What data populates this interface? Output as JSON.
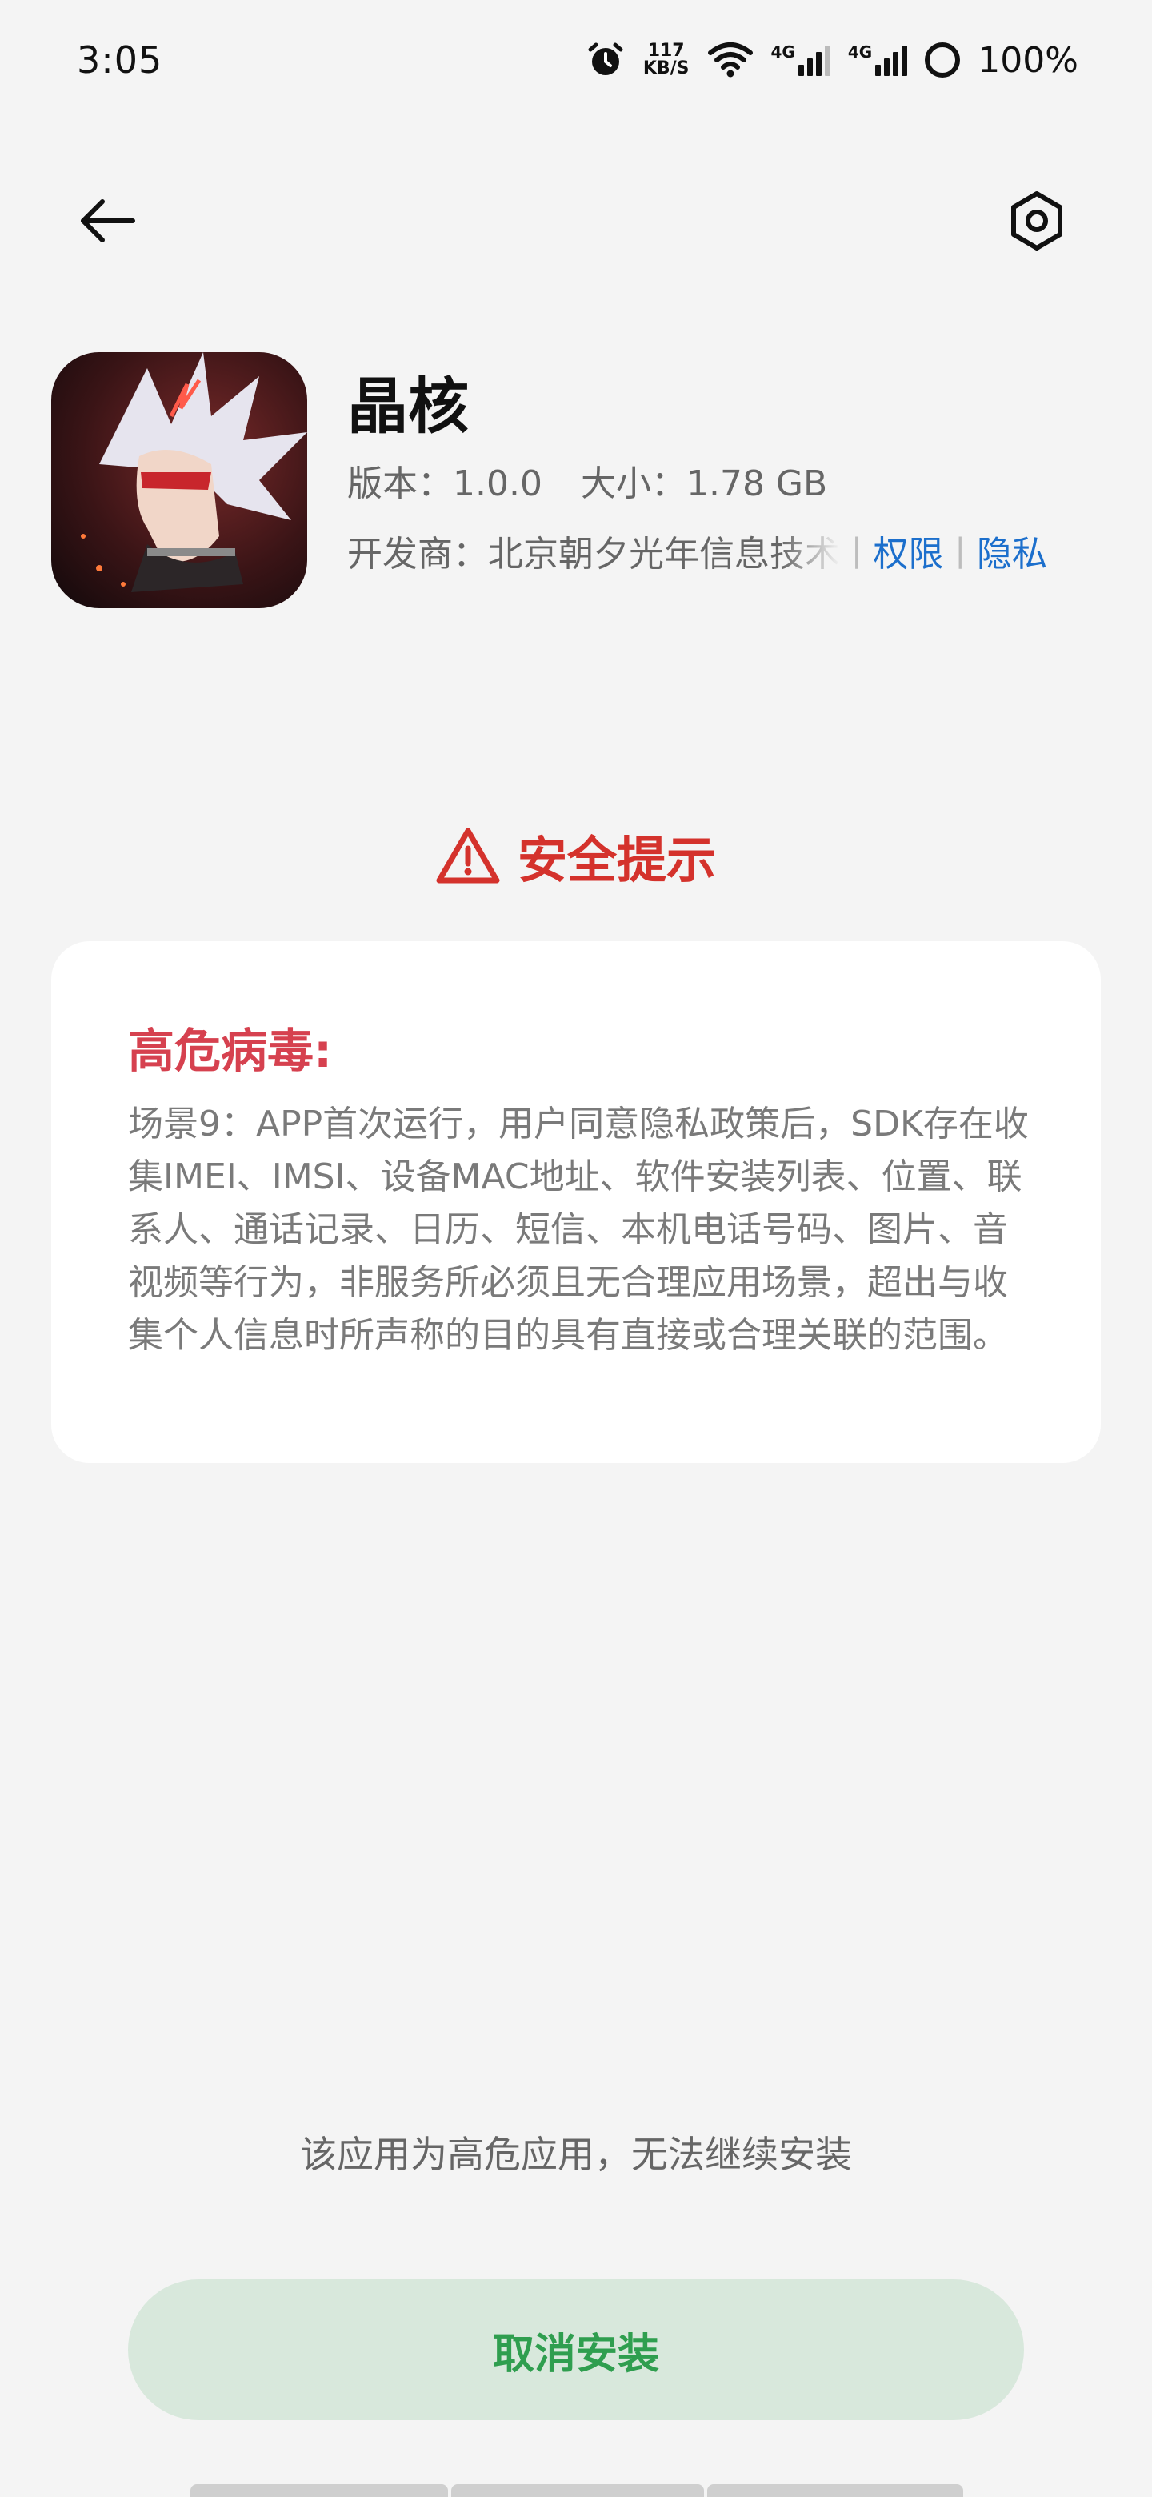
{
  "status_bar": {
    "time": "3:05",
    "speed_value": "117",
    "speed_unit": "KB/S",
    "net1_label": "4G",
    "net2_label": "4G",
    "battery": "100%"
  },
  "toolbar": {
    "back_icon": "arrow-left-icon",
    "settings_icon": "hexagon-settings-icon"
  },
  "app": {
    "name": "晶核",
    "version": "版本：1.0.0",
    "size": "大小：1.78 GB",
    "developer": "开发商：北京朝夕光年信息技术",
    "permissions_link": "权限",
    "privacy_link": "隐私",
    "separator": "|"
  },
  "security": {
    "title": "安全提示",
    "title_color": "#d4322c",
    "card_title": "高危病毒:",
    "card_body": "场景9：APP首次运行，用户同意隐私政策后，SDK存在收集IMEI、IMSI、设备MAC地址、软件安装列表、位置、联系人、通话记录、日历、短信、本机电话号码、图片、音视频等行为，非服务所必须且无合理应用场景，超出与收集个人信息时所声称的目的具有直接或合理关联的范围。"
  },
  "footer": {
    "warning": "该应用为高危应用，无法继续安装",
    "cancel_button": "取消安装",
    "accent": "#2f9e4f"
  }
}
